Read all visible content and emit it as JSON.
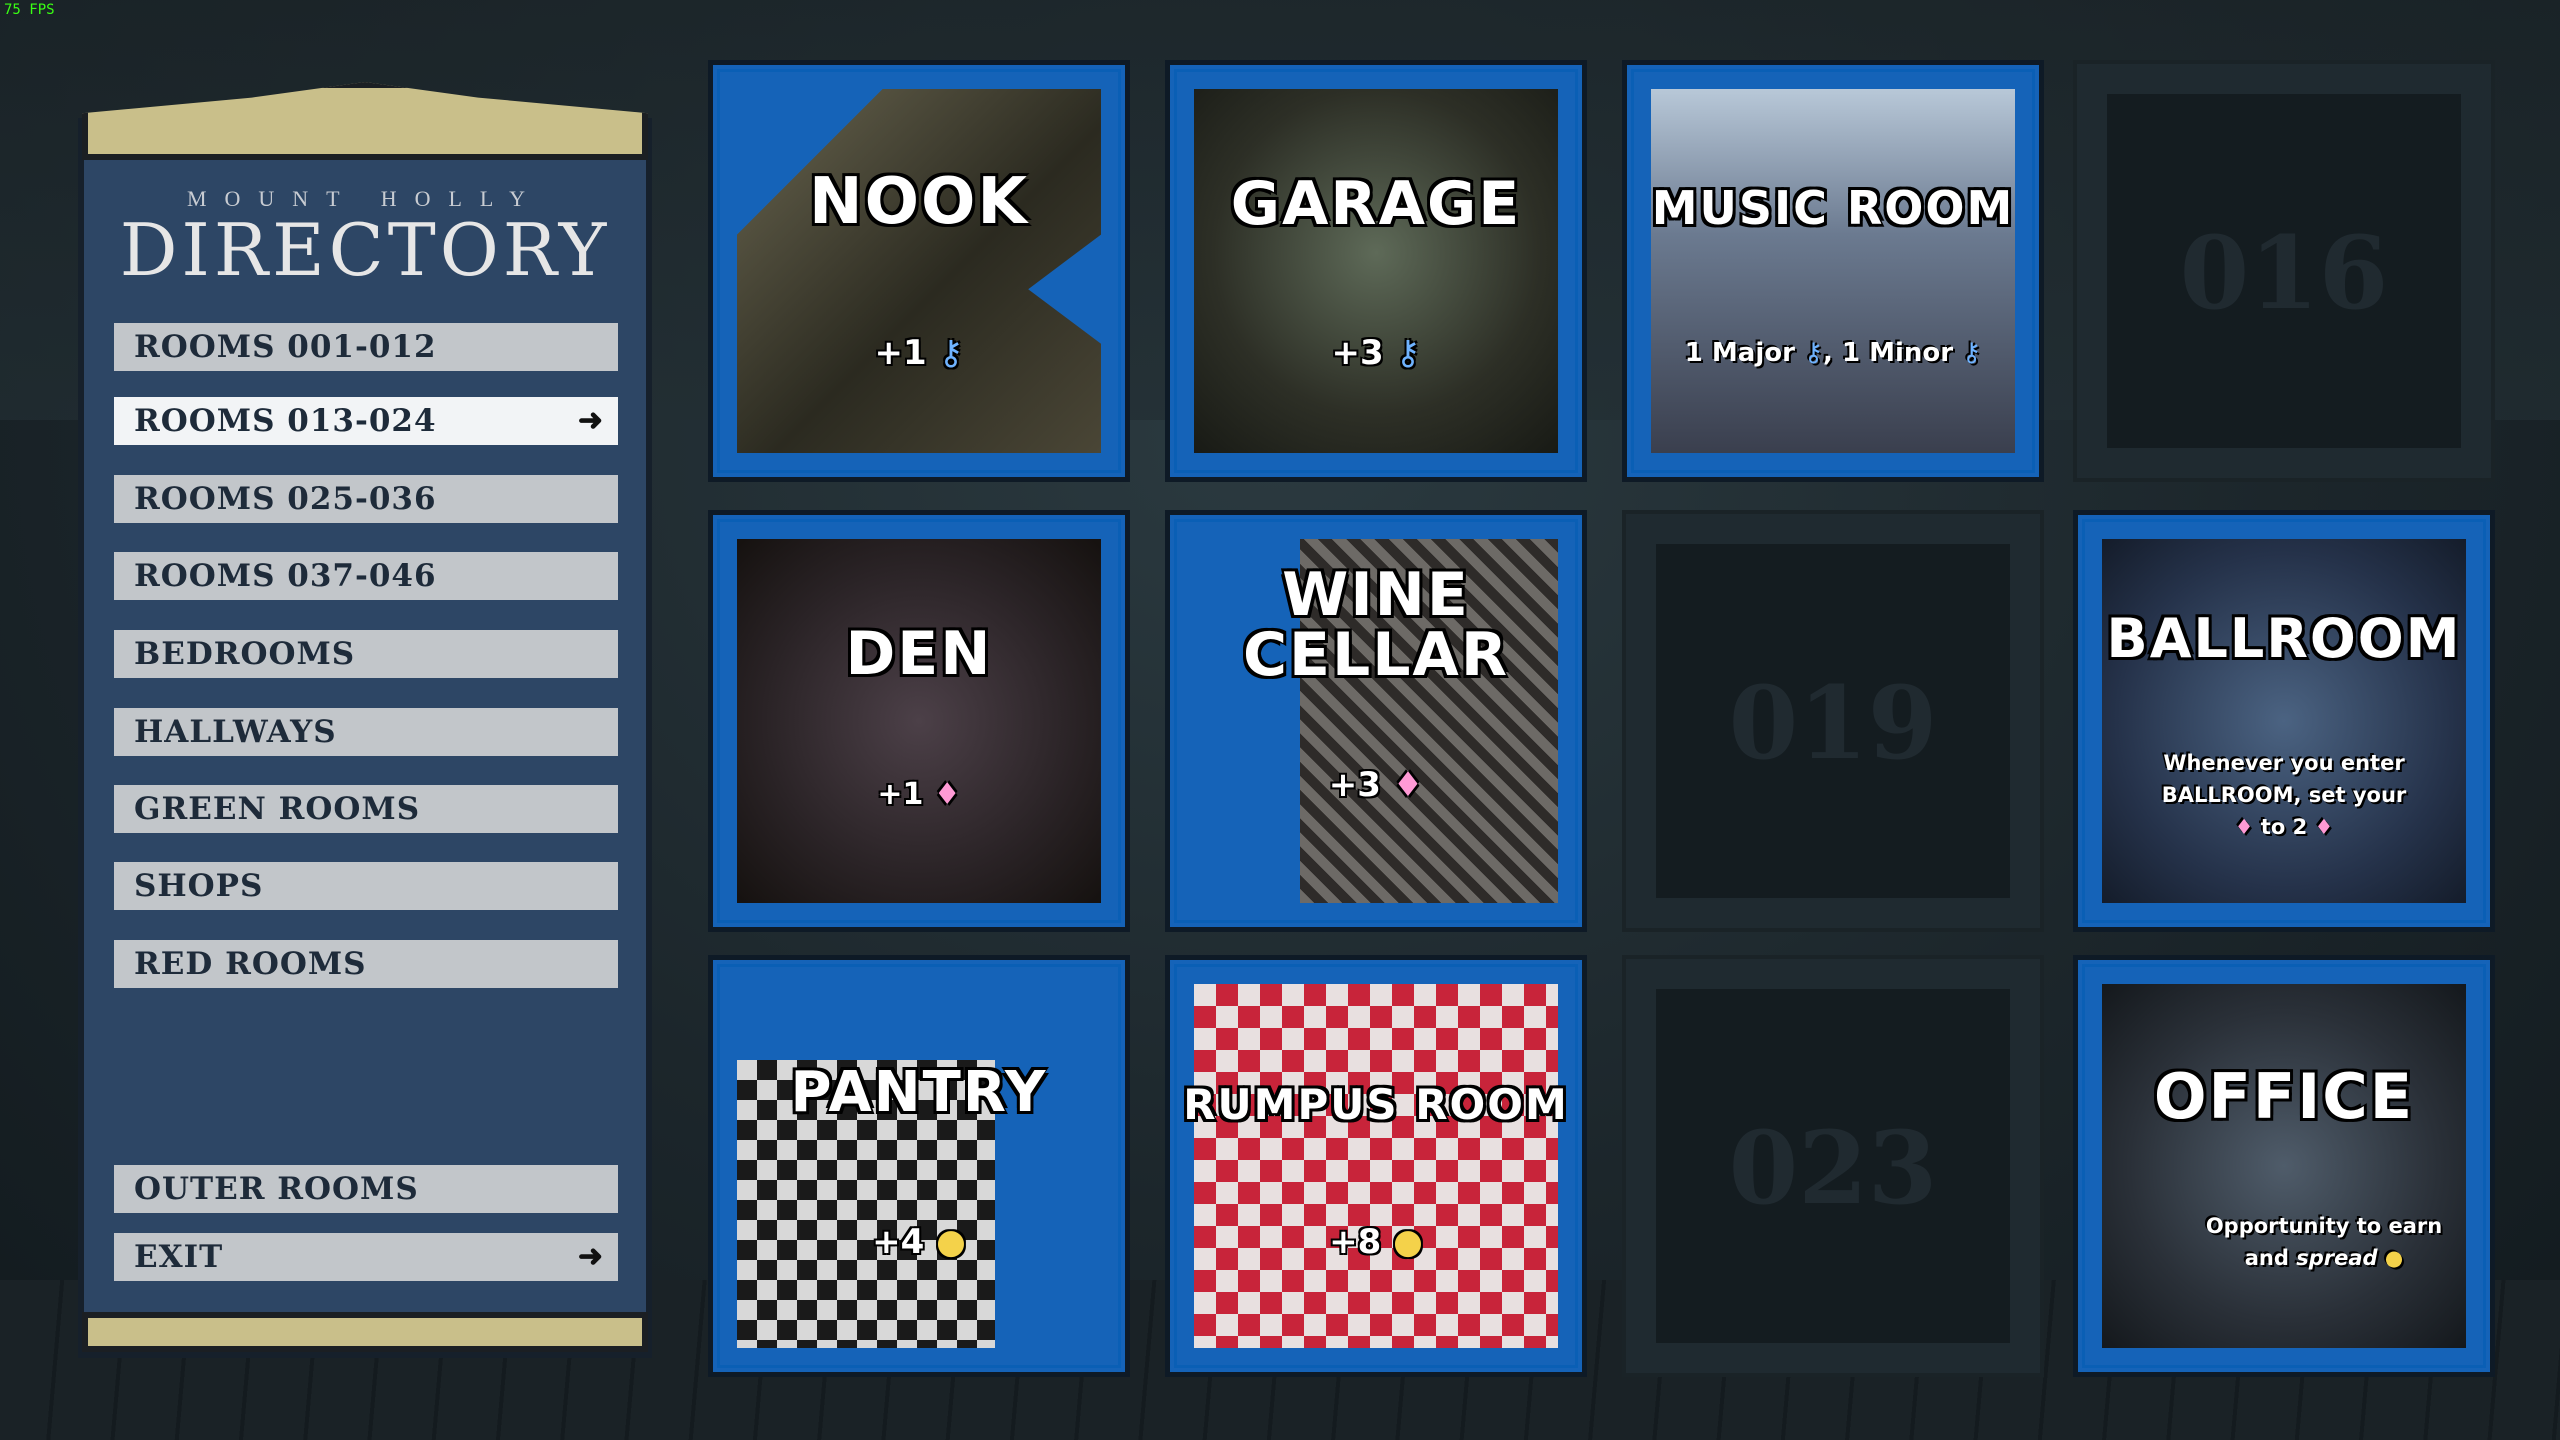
{
  "fps": "75 FPS",
  "directory": {
    "subtitle": "MOUNT HOLLY",
    "title": "DIRECTORY",
    "items": [
      {
        "label": "ROOMS 001-012"
      },
      {
        "label": "ROOMS 013-024",
        "active": true
      },
      {
        "label": "ROOMS 025-036"
      },
      {
        "label": "ROOMS 037-046"
      },
      {
        "label": "BEDROOMS"
      },
      {
        "label": "HALLWAYS"
      },
      {
        "label": "GREEN ROOMS"
      },
      {
        "label": "SHOPS"
      },
      {
        "label": "RED ROOMS"
      },
      {
        "label": "OUTER ROOMS"
      },
      {
        "label": "EXIT"
      }
    ],
    "active_arrow": "➜",
    "exit_arrow": "➜"
  },
  "rooms": {
    "nook": {
      "name": "NOOK",
      "cost": "+1",
      "icon": "key-icon"
    },
    "garage": {
      "name": "GARAGE",
      "cost": "+3",
      "icon": "key-icon"
    },
    "music_room": {
      "name": "MUSIC ROOM",
      "reward_a": "1 Major",
      "sep": ", ",
      "reward_b": "1 Minor",
      "icon": "key-icon"
    },
    "slot_016": {
      "number": "016"
    },
    "den": {
      "name": "DEN",
      "cost": "+1",
      "icon": "gem-icon"
    },
    "wine_cellar": {
      "name_line1": "WINE",
      "name_line2": "CELLAR",
      "cost": "+3",
      "icon": "gem-icon"
    },
    "slot_019": {
      "number": "019"
    },
    "ballroom": {
      "name": "BALLROOM",
      "line1": "Whenever you enter",
      "line2_bold": "BALLROOM",
      "line2_rest": ", set your",
      "line3": "to 2"
    },
    "pantry": {
      "name": "PANTRY",
      "cost": "+4",
      "icon": "coin-icon"
    },
    "rumpus_room": {
      "name": "RUMPUS ROOM",
      "cost": "+8",
      "icon": "coin-icon"
    },
    "slot_023": {
      "number": "023"
    },
    "office": {
      "name": "OFFICE",
      "line1": "Opportunity to earn",
      "line2a": "and",
      "line2b": "spread"
    }
  },
  "colors": {
    "tile_blue": "#1563b8",
    "panel_blue": "#2d4665",
    "key": "#6fb3ff",
    "gem": "#ff9ad5",
    "coin": "#f4d24a"
  }
}
